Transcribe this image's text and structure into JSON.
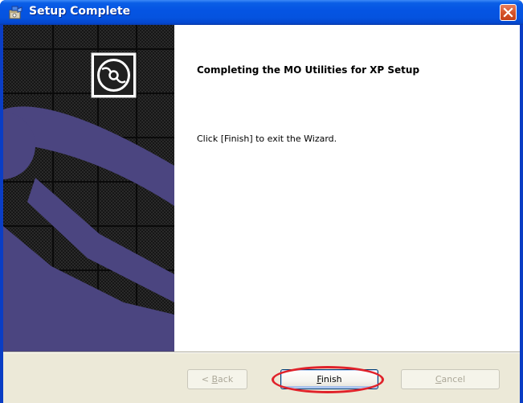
{
  "window": {
    "title": "Setup Complete"
  },
  "content": {
    "heading": "Completing the MO Utilities for XP  Setup",
    "message": "Click [Finish] to exit the Wizard."
  },
  "buttons": {
    "back": {
      "prefix": "< ",
      "mnemonic": "B",
      "rest": "ack",
      "enabled": false
    },
    "finish": {
      "prefix": "",
      "mnemonic": "F",
      "rest": "inish",
      "enabled": true
    },
    "cancel": {
      "prefix": "",
      "mnemonic": "C",
      "rest": "ancel",
      "enabled": false
    }
  },
  "icons": {
    "title": "installer-package-icon",
    "close": "close-icon",
    "banner": "cd-disc-icon"
  },
  "colors": {
    "title_bar": "#0554e3",
    "close_button": "#d6542c",
    "banner_shape": "#4b4580",
    "button_face": "#ece9d8",
    "highlight_ring": "#e0222a"
  }
}
